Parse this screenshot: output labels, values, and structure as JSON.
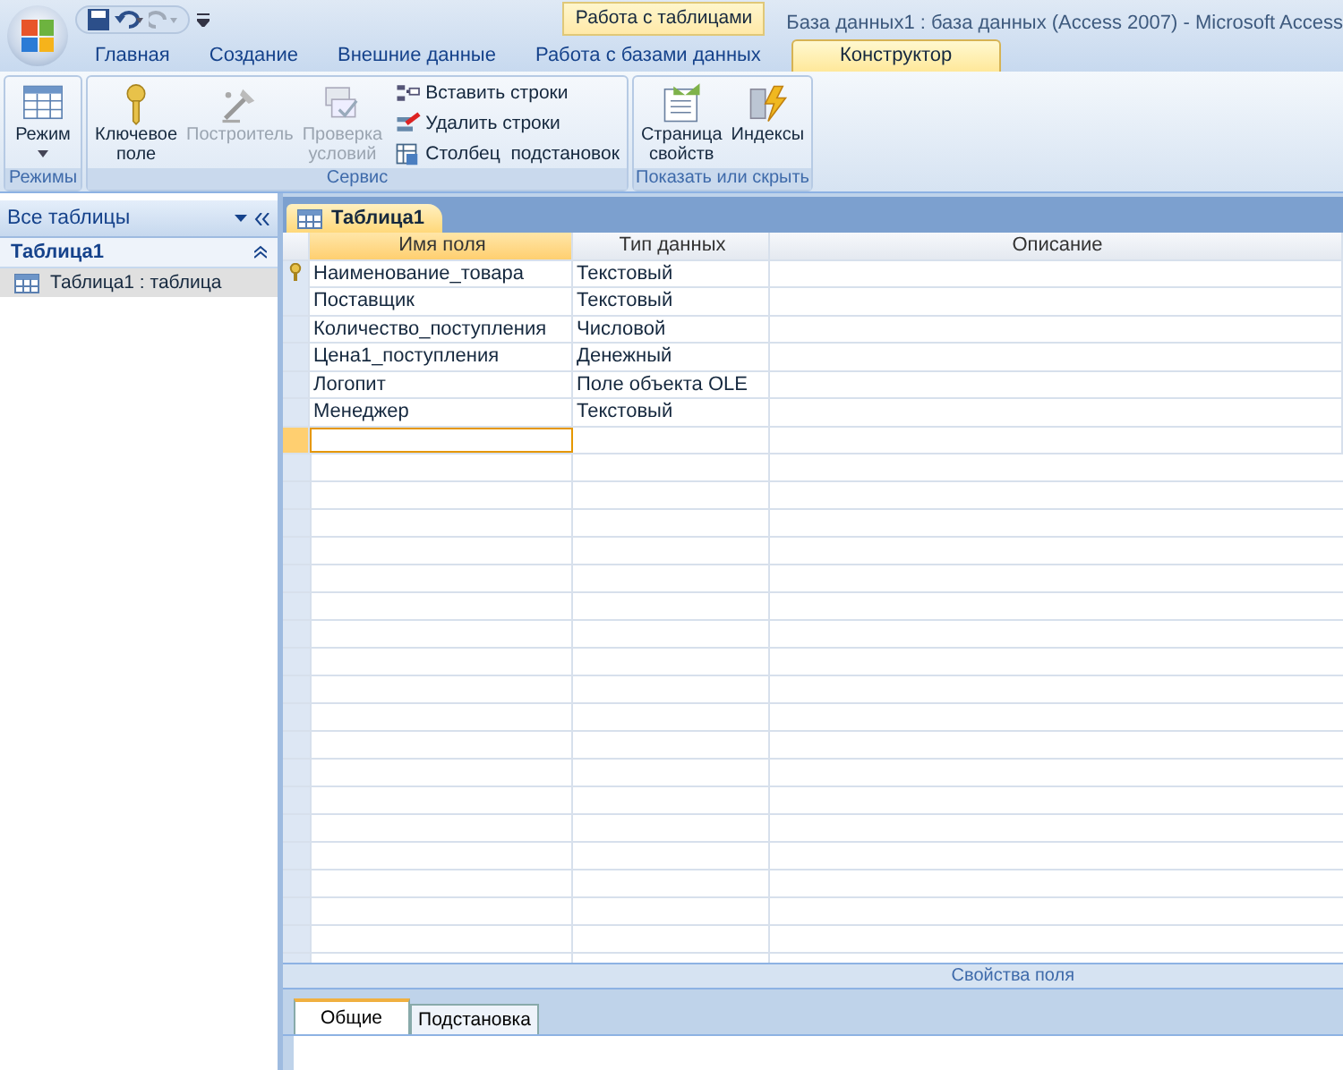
{
  "window": {
    "title": "База данных1 : база данных (Access 2007) - Microsoft Access"
  },
  "ribbon_tabs": [
    {
      "label": "Главная",
      "selected": false
    },
    {
      "label": "Создание",
      "selected": false
    },
    {
      "label": "Внешние данные",
      "selected": false
    },
    {
      "label": "Работа с базами данных",
      "selected": false
    },
    {
      "label": "Конструктор",
      "selected": true
    }
  ],
  "contextual_group": "Работа с таблицами",
  "ribbon_groups": [
    {
      "label": "Режимы",
      "buttons": [
        {
          "kind": "large",
          "label": "Режим",
          "disabled": false,
          "dropdown": true
        }
      ]
    },
    {
      "label": "Сервис",
      "buttons": [
        {
          "kind": "large",
          "label": "Ключевое поле",
          "disabled": false
        },
        {
          "kind": "large",
          "label": "Построитель",
          "disabled": true
        },
        {
          "kind": "large",
          "label": "Проверка условий",
          "disabled": true
        },
        {
          "kind": "small",
          "label": "Вставить строки",
          "disabled": false
        },
        {
          "kind": "small",
          "label": "Удалить строки",
          "disabled": false
        },
        {
          "kind": "small",
          "label": "Столбец  подстановок",
          "disabled": false
        }
      ]
    },
    {
      "label": "Показать или скрыть",
      "buttons": [
        {
          "kind": "large",
          "label": "Страница свойств",
          "disabled": false
        },
        {
          "kind": "large",
          "label": "Индексы",
          "disabled": false
        }
      ]
    }
  ],
  "nav_pane": {
    "title": "Все таблицы",
    "group": "Таблица1",
    "items": [
      {
        "label": "Таблица1 : таблица",
        "selected": true
      }
    ]
  },
  "document_tab": "Таблица1",
  "table": {
    "columns": [
      "Имя поля",
      "Тип данных",
      "Описание"
    ],
    "rows": [
      {
        "field": "Наименование_товара",
        "type": "Текстовый",
        "key": true
      },
      {
        "field": "Поставщик",
        "type": "Текстовый",
        "key": false
      },
      {
        "field": "Количество_поступления",
        "type": "Числовой",
        "key": false
      },
      {
        "field": "Цена1_поступления",
        "type": "Денежный",
        "key": false
      },
      {
        "field": "Логопит",
        "type": "Поле объекта OLE",
        "key": false
      },
      {
        "field": "Менеджер",
        "type": "Текстовый",
        "key": false
      }
    ],
    "new_row_selected": true
  },
  "properties": {
    "title": "Свойства поля",
    "tabs": [
      {
        "label": "Общие",
        "selected": true
      },
      {
        "label": "Подстановка",
        "selected": false
      }
    ]
  }
}
